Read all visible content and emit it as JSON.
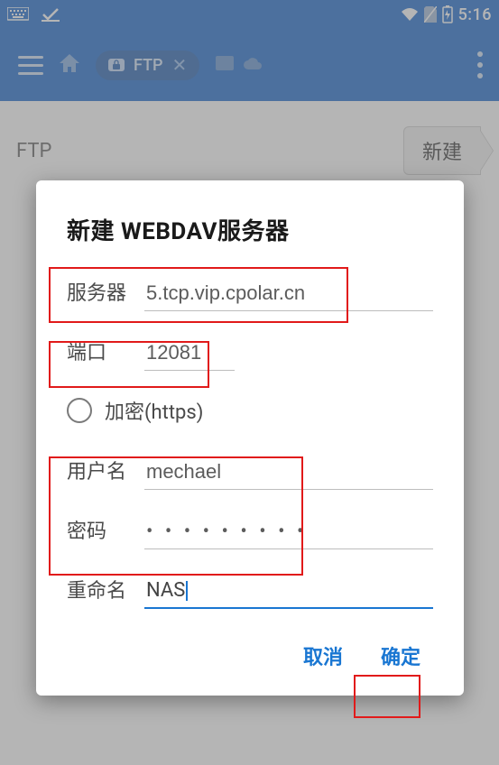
{
  "status": {
    "time": "5:16"
  },
  "toolbar": {
    "tab_label": "FTP"
  },
  "content": {
    "section_label": "FTP",
    "new_button": "新建"
  },
  "dialog": {
    "title": "新建 WEBDAV服务器",
    "server_label": "服务器",
    "server_value": "5.tcp.vip.cpolar.cn",
    "port_label": "端口",
    "port_value": "12081",
    "https_label": "加密(https)",
    "user_label": "用户名",
    "user_value": "mechael",
    "pass_label": "密码",
    "pass_value": "• • • • • • • • •",
    "rename_label": "重命名",
    "rename_value": "NAS",
    "cancel": "取消",
    "ok": "确定"
  }
}
